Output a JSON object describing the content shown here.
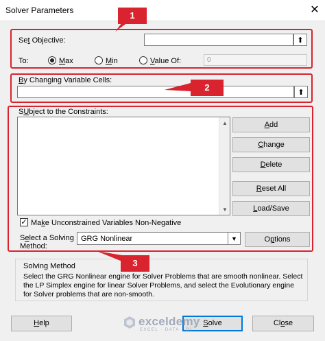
{
  "window": {
    "title": "Solver Parameters",
    "close_glyph": "✕"
  },
  "objective": {
    "set_objective_prefix": "Se",
    "set_objective_key": "t",
    "set_objective_suffix": " Objective:",
    "to_label": "To:",
    "options": [
      {
        "key": "M",
        "rest": "ax",
        "checked": true
      },
      {
        "key": "M",
        "rest": "in",
        "checked": false
      },
      {
        "key": "V",
        "rest": "alue Of:",
        "checked": false
      }
    ],
    "value_of": "0"
  },
  "changing": {
    "key": "B",
    "rest": "y Changing Variable Cells:"
  },
  "constraints": {
    "key": "U",
    "label_first": "S",
    "label_rest": "bject to the Constraints:",
    "buttons": [
      {
        "key": "A",
        "rest": "dd"
      },
      {
        "key": "C",
        "rest": "hange"
      },
      {
        "key": "D",
        "rest": "elete"
      },
      {
        "key": "R",
        "rest": "eset All"
      },
      {
        "key": "L",
        "rest": "oad/Save"
      }
    ],
    "checkbox_pre": "Ma",
    "checkbox_key": "k",
    "checkbox_rest": "e Unconstrained Variables Non-Negative",
    "checkbox_checked": true,
    "method_line1_pre": "S",
    "method_line1_key": "e",
    "method_line1_rest": "lect a Solving",
    "method_line2": "Method:",
    "method_value": "GRG Nonlinear",
    "options_button_key": "p",
    "options_button_pre": "O",
    "options_button_rest": "tions"
  },
  "solving_method": {
    "heading": "Solving Method",
    "description": "Select the GRG Nonlinear engine for Solver Problems that are smooth nonlinear. Select the LP Simplex engine for linear Solver Problems, and select the Evolutionary engine for Solver problems that are non-smooth."
  },
  "footer": {
    "help_key": "H",
    "help_rest": "elp",
    "solve_key": "S",
    "solve_rest": "olve",
    "close_pre": "Cl",
    "close_key": "o",
    "close_rest": "se"
  },
  "callouts": [
    "1",
    "2",
    "3"
  ],
  "watermark": {
    "name": "exceldemy",
    "tagline": "EXCEL · DATA · BI"
  },
  "colors": {
    "highlight": "#d9232e",
    "focus_blue": "#0078d7"
  }
}
